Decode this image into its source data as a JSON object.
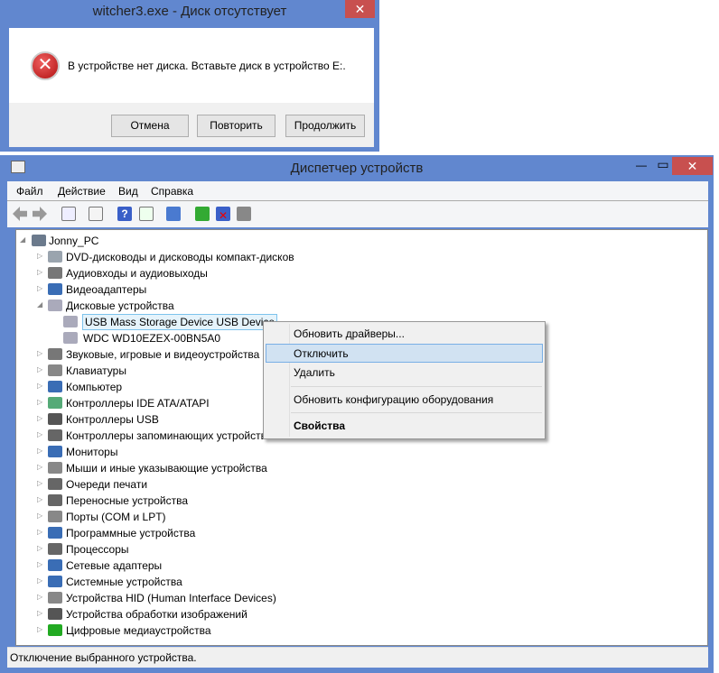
{
  "dialog": {
    "title": "witcher3.exe - Диск отсутствует",
    "message": "В устройстве нет диска. Вставьте диск в устройство E:.",
    "buttons": [
      "Отмена",
      "Повторить",
      "Продолжить"
    ],
    "close": "✕",
    "icon": "error-icon"
  },
  "window": {
    "title": "Диспетчер устройств",
    "controls": {
      "minimize": "—",
      "maximize": "▭",
      "close": "✕"
    },
    "menu": [
      "Файл",
      "Действие",
      "Вид",
      "Справка"
    ],
    "status": "Отключение выбранного устройства."
  },
  "tree": [
    {
      "label": "Jonny_PC",
      "level": 0,
      "expanded": true,
      "color": "#6b7a8c"
    },
    {
      "label": "DVD-дисководы и дисководы компакт-дисков",
      "level": 1,
      "color": "#9aa4ae"
    },
    {
      "label": "Аудиовходы и аудиовыходы",
      "level": 1,
      "color": "#777"
    },
    {
      "label": "Видеоадаптеры",
      "level": 1,
      "color": "#3a6db5"
    },
    {
      "label": "Дисковые устройства",
      "level": 1,
      "expanded": true,
      "color": "#aab"
    },
    {
      "label": "USB Mass  Storage Device USB Device",
      "level": 2,
      "selected": true,
      "color": "#aab"
    },
    {
      "label": "WDC WD10EZEX-00BN5A0",
      "level": 2,
      "color": "#aab"
    },
    {
      "label": "Звуковые, игровые и видеоустройства",
      "level": 1,
      "color": "#777"
    },
    {
      "label": "Клавиатуры",
      "level": 1,
      "color": "#888"
    },
    {
      "label": "Компьютер",
      "level": 1,
      "color": "#3a6db5"
    },
    {
      "label": "Контроллеры IDE ATA/ATAPI",
      "level": 1,
      "color": "#5a7"
    },
    {
      "label": "Контроллеры USB",
      "level": 1,
      "color": "#555"
    },
    {
      "label": "Контроллеры запоминающих устройств",
      "level": 1,
      "color": "#666"
    },
    {
      "label": "Мониторы",
      "level": 1,
      "color": "#3a6db5"
    },
    {
      "label": "Мыши и иные указывающие устройства",
      "level": 1,
      "color": "#888"
    },
    {
      "label": "Очереди печати",
      "level": 1,
      "color": "#666"
    },
    {
      "label": "Переносные устройства",
      "level": 1,
      "color": "#666"
    },
    {
      "label": "Порты (COM и LPT)",
      "level": 1,
      "color": "#888"
    },
    {
      "label": "Программные устройства",
      "level": 1,
      "color": "#3a6db5"
    },
    {
      "label": "Процессоры",
      "level": 1,
      "color": "#666"
    },
    {
      "label": "Сетевые адаптеры",
      "level": 1,
      "color": "#3a6db5"
    },
    {
      "label": "Системные устройства",
      "level": 1,
      "color": "#3a6db5"
    },
    {
      "label": "Устройства HID (Human Interface Devices)",
      "level": 1,
      "color": "#888"
    },
    {
      "label": "Устройства обработки изображений",
      "level": 1,
      "color": "#555"
    },
    {
      "label": "Цифровые медиаустройства",
      "level": 1,
      "color": "#2a2"
    }
  ],
  "context_menu": {
    "items": [
      "Обновить драйверы...",
      "Отключить",
      "Удалить",
      "Обновить конфигурацию оборудования",
      "Свойства"
    ],
    "highlighted": "Отключить"
  }
}
